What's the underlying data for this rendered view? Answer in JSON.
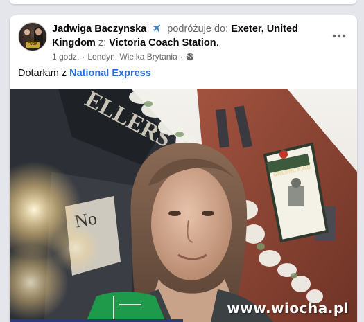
{
  "post": {
    "author": "Jadwiga Baczynska",
    "activity": "podróżuje do:",
    "destination": "Exeter, United Kingdom",
    "from_word": "z:",
    "origin": "Victoria Coach Station",
    "period": ".",
    "time": "1 godz.",
    "separator": "·",
    "location": "Londyn, Wielka Brytania",
    "separator2": "·",
    "text_prefix": "Dotarłam z",
    "text_link": "National Express"
  },
  "avatar": {
    "stamp_text": "FUDA"
  },
  "photo": {
    "sign_top": "ELLERS",
    "sign_number": "No",
    "pub_sign": "GREENE KING",
    "watermark": "www.wiocha.pl"
  },
  "icons": {
    "travel": "airplane-icon",
    "privacy": "globe-icon",
    "more": "more-options-icon"
  },
  "colors": {
    "link": "#216fdb",
    "muted": "#65676b",
    "text": "#050505",
    "background": "#e4e6eb"
  }
}
